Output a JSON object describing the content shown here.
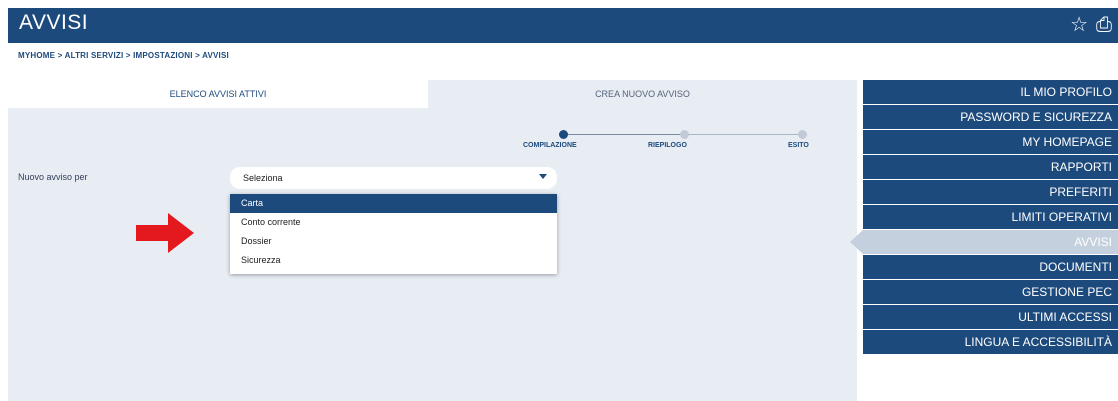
{
  "header": {
    "title": "AVVISI",
    "icons": [
      "star-icon",
      "print-icon"
    ]
  },
  "breadcrumb": "MYHOME > ALTRI SERVIZI > IMPOSTAZIONI > AVVISI",
  "tabs": [
    {
      "label": "ELENCO AVVISI ATTIVI",
      "active": true
    },
    {
      "label": "CREA NUOVO AVVISO",
      "active": false
    }
  ],
  "stepper": {
    "steps": [
      "COMPILAZIONE",
      "RIEPILOGO",
      "ESITO"
    ],
    "current": 0
  },
  "form": {
    "label": "Nuovo avviso per",
    "select_value": "Seleziona",
    "options": [
      "Carta",
      "Conto corrente",
      "Dossier",
      "Sicurezza"
    ],
    "highlighted": "Carta"
  },
  "sidebar": {
    "items": [
      {
        "label": "IL MIO PROFILO"
      },
      {
        "label": "PASSWORD E SICUREZZA"
      },
      {
        "label": "MY HOMEPAGE"
      },
      {
        "label": "RAPPORTI"
      },
      {
        "label": "PREFERITI"
      },
      {
        "label": "LIMITI OPERATIVI"
      },
      {
        "label": "AVVISI",
        "active": true
      },
      {
        "label": "DOCUMENTI"
      },
      {
        "label": "GESTIONE PEC"
      },
      {
        "label": "ULTIMI ACCESSI"
      },
      {
        "label": "LINGUA E ACCESSIBILITÀ"
      }
    ]
  },
  "colors": {
    "brand": "#1d4a7c",
    "arrow": "#e3191e",
    "panel": "#e8edf4"
  }
}
